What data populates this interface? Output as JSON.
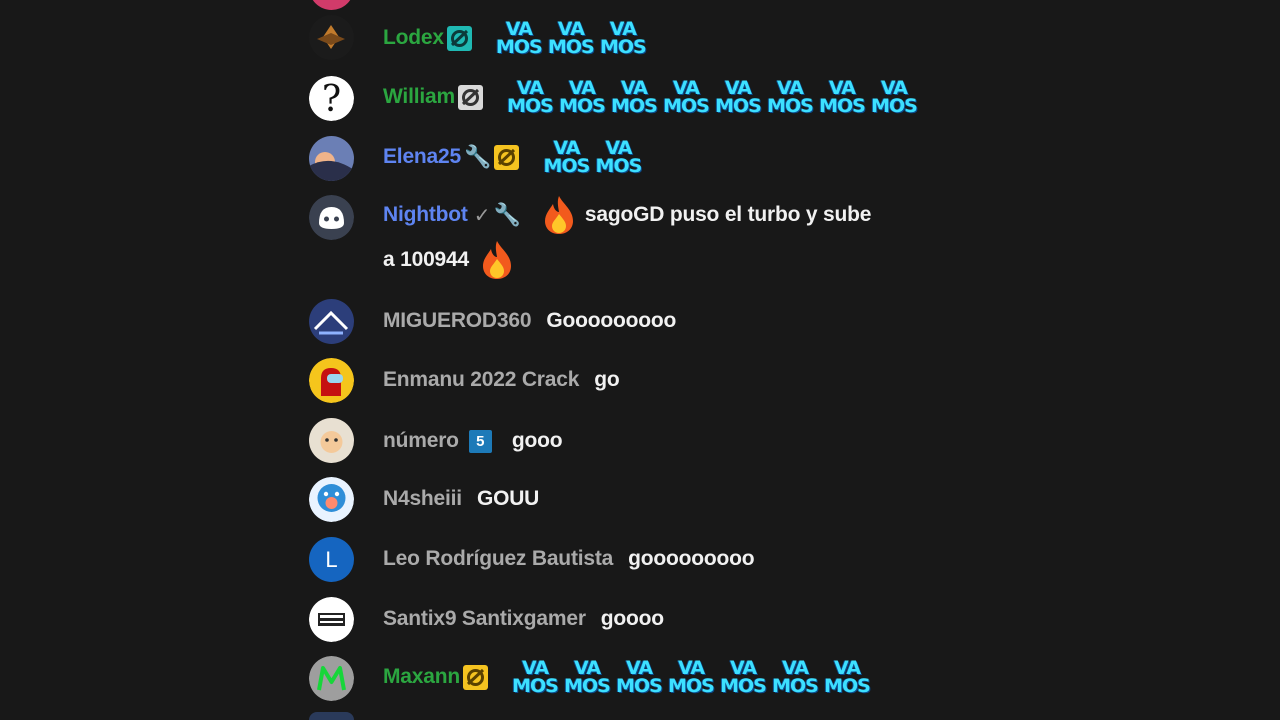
{
  "messages": [
    {
      "author": "Lodex",
      "emotes": [
        "VA MOS",
        "VA MOS",
        "VA MOS"
      ]
    },
    {
      "author": "William",
      "emotes": [
        "VA MOS",
        "VA MOS",
        "VA MOS",
        "VA MOS",
        "VA MOS",
        "VA MOS",
        "VA MOS",
        "VA MOS"
      ]
    },
    {
      "author": "Elena25",
      "emotes": [
        "VA MOS",
        "VA MOS"
      ]
    },
    {
      "author": "Nightbot",
      "text_line1": "sagoGD puso el turbo y sube",
      "text_line2": "a 100944"
    },
    {
      "author": "MIGUEROD360",
      "text": "Gooooooooo"
    },
    {
      "author": "Enmanu 2022 Crack",
      "text": "go"
    },
    {
      "author": "número",
      "member_badge": "5",
      "text": "gooo"
    },
    {
      "author": "N4sheiii",
      "text": "GOUU"
    },
    {
      "author": "Leo Rodríguez Bautista",
      "avatar_letter": "L",
      "text": "gooooooooo"
    },
    {
      "author": "Santix9 Santixgamer",
      "text": "goooo"
    },
    {
      "author": "Maxann",
      "emotes": [
        "VA MOS",
        "VA MOS",
        "VA MOS",
        "VA MOS",
        "VA MOS",
        "VA MOS",
        "VA MOS"
      ]
    }
  ],
  "emote_text": {
    "top": "VA",
    "bottom": "MOS"
  },
  "colors": {
    "background": "#181818",
    "member_name": "#2ba640",
    "moderator_name": "#5e84f1",
    "viewer_name": "#aaaaaa",
    "message_text": "#f1f1f1",
    "emote": "#3de0ff"
  },
  "icons": {
    "moderator": "wrench-icon",
    "verified": "check-icon",
    "emoji": "fire-emoji-icon"
  }
}
